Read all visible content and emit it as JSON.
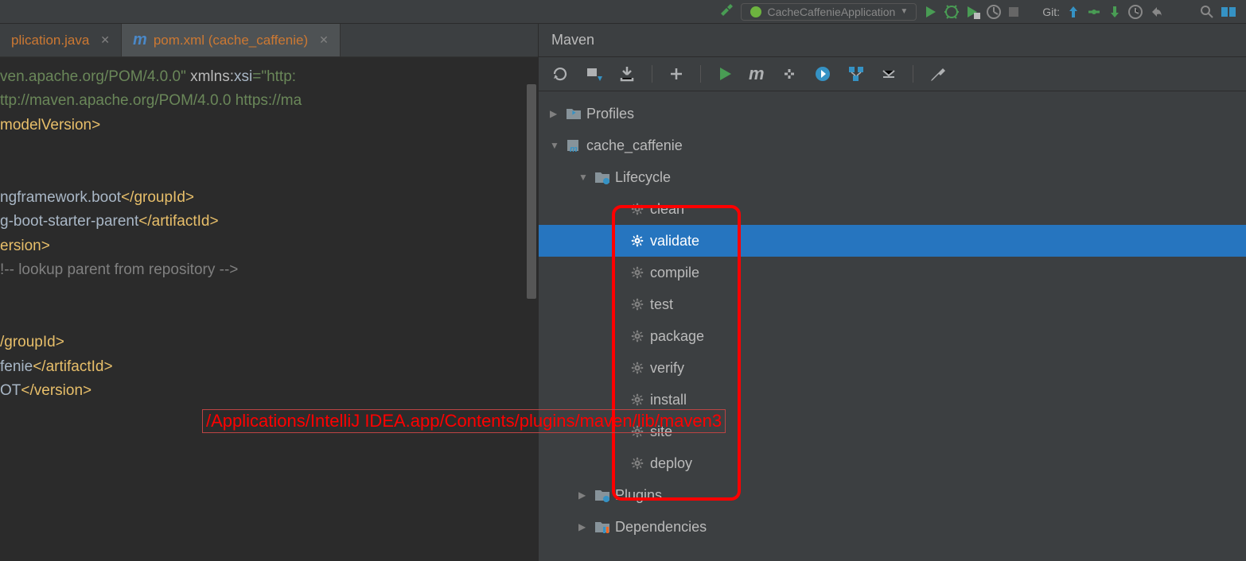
{
  "topbar": {
    "run_config": "CacheCaffenieApplication"
  },
  "tabs": [
    {
      "label": "plication.java",
      "icon": "java"
    },
    {
      "label": "pom.xml (cache_caffenie)",
      "icon": "m",
      "active": true
    }
  ],
  "code": {
    "l1a": "ven.apache.org/POM/4.0.0\"",
    "l1b": " xmlns:",
    "l1c": "xsi",
    "l1d": "=\"http:",
    "l2": "ttp://maven.apache.org/POM/4.0.0 https://ma",
    "l3": "modelVersion>",
    "l4a": "ngframework.boot",
    "l4b": "</groupId>",
    "l5a": "g-boot-starter-parent",
    "l5b": "</artifactId>",
    "l6": "ersion>",
    "l7": "!-- lookup parent from repository -->",
    "l8": "/groupId>",
    "l9a": "fenie",
    "l9b": "</artifactId>",
    "l10a": "OT",
    "l10b": "</version>"
  },
  "maven": {
    "title": "Maven",
    "tree": {
      "profiles": "Profiles",
      "project": "cache_caffenie",
      "lifecycle": "Lifecycle",
      "goals": [
        "clean",
        "validate",
        "compile",
        "test",
        "package",
        "verify",
        "install",
        "site",
        "deploy"
      ],
      "selected_goal": "validate",
      "plugins": "Plugins",
      "dependencies": "Dependencies"
    }
  },
  "annotation": "/Applications/IntelliJ IDEA.app/Contents/plugins/maven/lib/maven3"
}
